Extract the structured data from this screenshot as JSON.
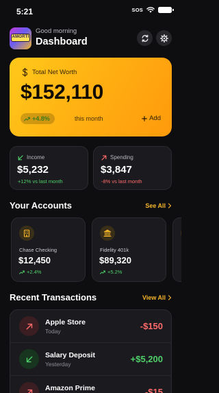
{
  "status_bar": {
    "time": "5:21",
    "sos": "SOS"
  },
  "header": {
    "avatar_text": "AMORTI",
    "greeting": "Good morning",
    "title": "Dashboard",
    "icons": [
      "refresh-icon",
      "gear-icon"
    ]
  },
  "net_worth": {
    "label": "Total Net Worth",
    "value": "$152,110",
    "change": "+4.8%",
    "period": "this month",
    "add_label": "Add"
  },
  "income": {
    "label": "Income",
    "amount": "$5,232",
    "change": "+12% vs last month"
  },
  "spending": {
    "label": "Spending",
    "amount": "$3,847",
    "change": "-8% vs last month"
  },
  "accounts": {
    "title": "Your Accounts",
    "see_all": "See All",
    "items": [
      {
        "name": "Chase Checking",
        "balance": "$12,450",
        "change": "+2.4%",
        "icon": "bank-building-icon"
      },
      {
        "name": "Fidelity 401k",
        "balance": "$89,320",
        "change": "+5.2%",
        "icon": "institution-icon"
      },
      {
        "name": "",
        "balance": "",
        "change": "",
        "icon": "account-icon"
      }
    ]
  },
  "transactions": {
    "title": "Recent Transactions",
    "view_all": "View All",
    "items": [
      {
        "name": "Apple Store",
        "date": "Today",
        "amount": "-$150"
      },
      {
        "name": "Salary Deposit",
        "date": "Yesterday",
        "amount": "+$5,200"
      },
      {
        "name": "Amazon Prime",
        "date": "",
        "amount": "-$15"
      }
    ]
  },
  "colors": {
    "accent": "#f5b62a",
    "positive": "#4fd06a",
    "negative": "#ff6b6b",
    "background": "#0e0e10",
    "card": "#1b1b1f"
  }
}
